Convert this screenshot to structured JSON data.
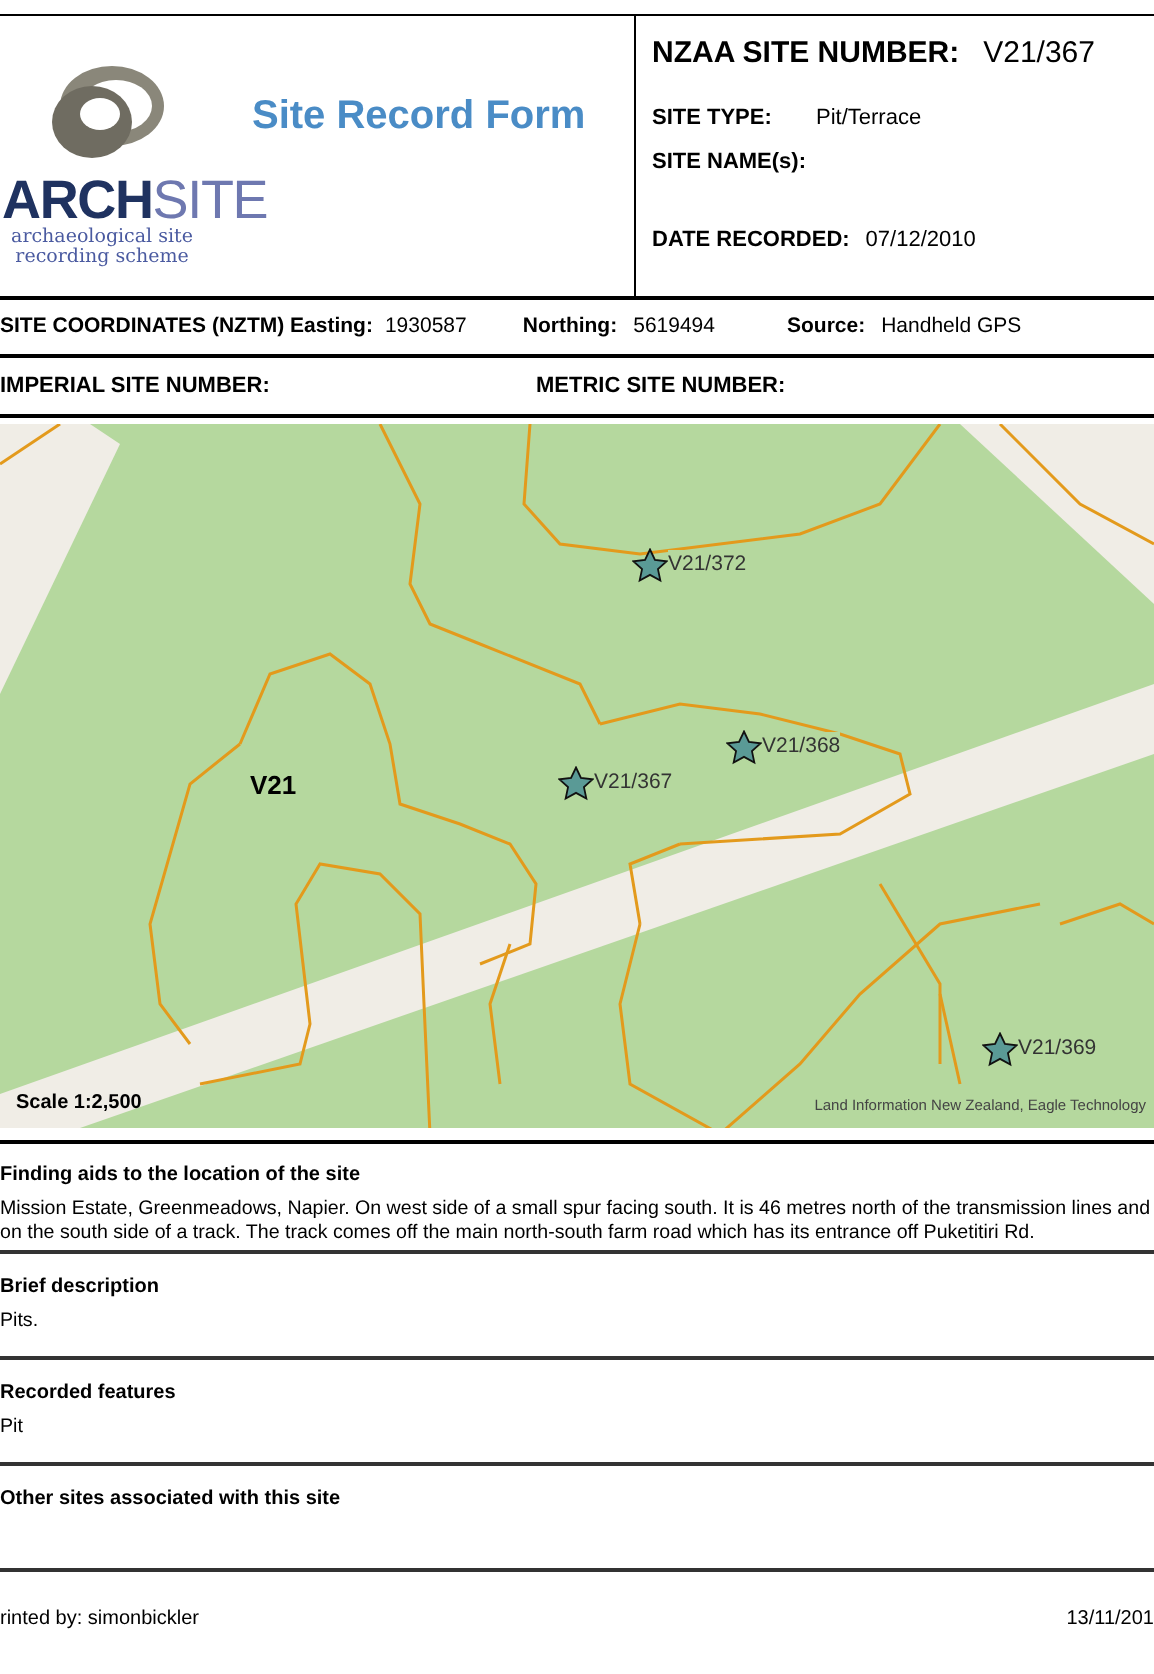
{
  "logo": {
    "wordmark_first": "ARCH",
    "wordmark_second": "SITE",
    "tagline": "archaeological site recording scheme"
  },
  "form_title": "Site Record Form",
  "site_number": {
    "label": "NZAA SITE NUMBER:",
    "value": "V21/367"
  },
  "site_fields": [
    {
      "label": "SITE TYPE:",
      "value": "Pit/Terrace"
    },
    {
      "label": "SITE NAME(s):"
    }
  ],
  "date_recorded": {
    "label": "DATE RECORDED:",
    "value": "07/12/2010"
  },
  "coordinates": [
    {
      "label": "SITE COORDINATES (NZTM) Easting:",
      "value": "1930587"
    },
    {
      "label": "Northing:",
      "value": "5619494"
    },
    {
      "label": "Source:",
      "value": "Handheld GPS"
    }
  ],
  "other_numbers": [
    {
      "label": "IMPERIAL SITE NUMBER:"
    },
    {
      "label": "METRIC SITE NUMBER:"
    }
  ],
  "map": {
    "sheet_label": "V21",
    "scale": "Scale 1:2,500",
    "attribution": "Land Information New Zealand, Eagle Technology",
    "sites": [
      {
        "label": "V21/372"
      },
      {
        "label": "V21/368"
      },
      {
        "label": "V21/367"
      },
      {
        "label": "V21/369"
      }
    ]
  },
  "sections": [
    {
      "heading": "Finding aids to the location of the site",
      "text": "Mission Estate, Greenmeadows, Napier. On west side of a small spur facing south. It is 46 metres north of the transmission lines and on the south side of a track. The track comes off the main north-south farm road which has its entrance off Puketitiri Rd."
    },
    {
      "heading": "Brief description",
      "text": "Pits."
    },
    {
      "heading": "Recorded features",
      "text": "Pit"
    },
    {
      "heading": "Other sites associated with this site"
    }
  ],
  "footer": {
    "printed_by": "rinted by: simonbickler",
    "date": "13/11/201"
  }
}
